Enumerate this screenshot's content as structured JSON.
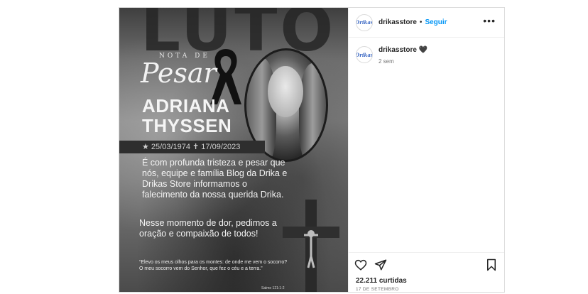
{
  "post": {
    "image": {
      "watermark": "LUTO",
      "nota_de": "NOTA DE",
      "pesar": "Pesar",
      "name_line1": "ADRIANA",
      "name_line2": "THYSSEN",
      "dates": "★ 25/03/1974  ✝ 17/09/2023",
      "message1": "É com profunda tristeza e pesar que nós, equipe e família Blog da Drika e Drikas Store informamos o falecimento da nossa querida Drika.",
      "message2": "Nesse momento de dor, pedimos a oração e compaixão de todos!",
      "quote": "“Elevo os meus olhos para os montes: de onde me vem o socorro? O meu socorro vem do Senhor, que fez o céu e a terra.”",
      "quote_ref": "Salmo 121:1-2"
    },
    "header": {
      "avatar_text": "Drikas",
      "username": "drikasstore",
      "separator": "•",
      "follow_label": "Seguir",
      "more_label": "•••"
    },
    "caption": {
      "username": "drikasstore",
      "text": "🖤",
      "time": "2 sem"
    },
    "stats": {
      "likes": "22.211 curtidas",
      "date": "17 DE SETEMBRO"
    },
    "icons": {
      "like": "heart-icon",
      "share": "send-icon",
      "save": "bookmark-icon",
      "more": "more-options-icon"
    }
  }
}
